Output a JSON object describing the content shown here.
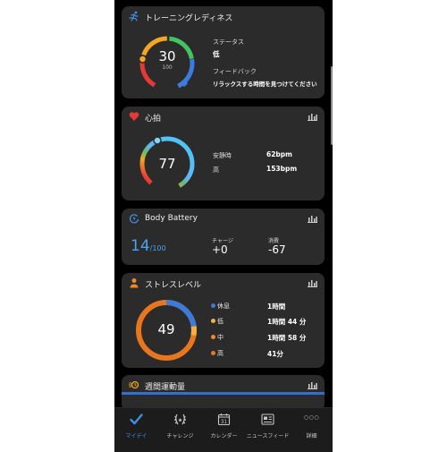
{
  "training_readiness": {
    "title": "トレーニングレディネス",
    "score": "30",
    "max": "100",
    "status_label": "ステータス",
    "status_value": "低",
    "feedback_label": "フィードバック",
    "feedback_value": "リラックスする時間を見つけてください"
  },
  "heart_rate": {
    "title": "心拍",
    "current": "77",
    "resting_label": "安静時",
    "resting_value": "62bpm",
    "high_label": "高",
    "high_value": "153bpm"
  },
  "body_battery": {
    "title": "Body Battery",
    "value": "14",
    "max": "/100",
    "charge_label": "チャージ",
    "charge_value": "+0",
    "drain_label": "消費",
    "drain_value": "-67"
  },
  "stress": {
    "title": "ストレスレベル",
    "value": "49",
    "rows": [
      {
        "label": "休息",
        "value": "1時間",
        "color": "#3b7bd9"
      },
      {
        "label": "低",
        "value": "1時間 44 分",
        "color": "#f5b041"
      },
      {
        "label": "中",
        "value": "1時間 58 分",
        "color": "#f08a24"
      },
      {
        "label": "高",
        "value": "41分",
        "color": "#e8761e"
      }
    ]
  },
  "weekly": {
    "title": "週間運動量",
    "bar_color": "#2f6fd6"
  },
  "tabbar": {
    "tabs": [
      {
        "label": "マイデイ",
        "icon": "checkmark-icon",
        "active": true
      },
      {
        "label": "チャレンジ",
        "icon": "laurel-icon",
        "active": false
      },
      {
        "label": "カレンダー",
        "icon": "calendar-icon",
        "active": false,
        "icon_text": "31"
      },
      {
        "label": "ニュースフィード",
        "icon": "newsfeed-icon",
        "active": false
      },
      {
        "label": "詳細",
        "icon": "more-icon",
        "active": false,
        "icon_text": "○○○"
      }
    ]
  },
  "colors": {
    "accent": "#3d8fe0",
    "heart": "#e53935",
    "stress": "#f08a24",
    "card": "#2b2b2b"
  }
}
